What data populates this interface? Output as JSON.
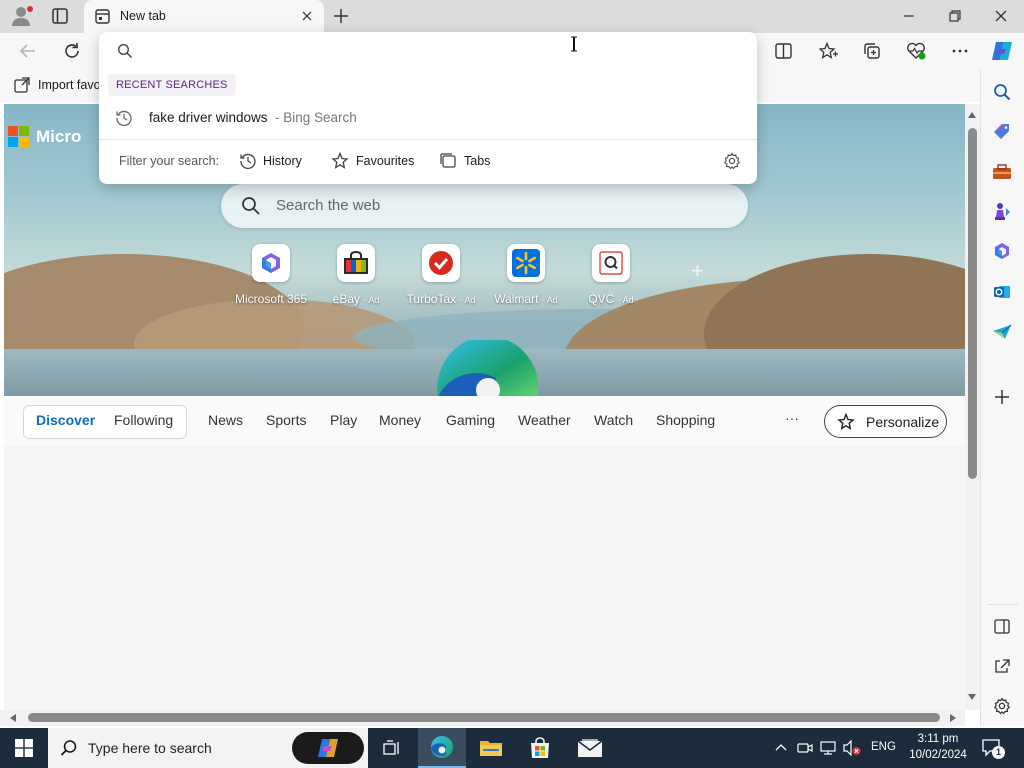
{
  "window": {
    "tab_title": "New tab"
  },
  "favorites_bar": {
    "import_label": "Import favo"
  },
  "address_dropdown": {
    "section_title": "RECENT SEARCHES",
    "recent": [
      {
        "query": "fake driver windows",
        "suffix": "- Bing Search"
      }
    ],
    "filter_label": "Filter your search:",
    "filters": [
      "History",
      "Favourites",
      "Tabs"
    ]
  },
  "newtab": {
    "brand_text": "Micro",
    "search_placeholder": "Search the web",
    "quick_links": [
      {
        "label": "Microsoft 365",
        "ad": ""
      },
      {
        "label": "eBay",
        "ad": "· Ad"
      },
      {
        "label": "TurboTax",
        "ad": "· Ad"
      },
      {
        "label": "Walmart",
        "ad": "· Ad"
      },
      {
        "label": "QVC",
        "ad": "· Ad"
      }
    ],
    "add_shortcut": "+",
    "feed_tabs": {
      "discover": "Discover",
      "following": "Following",
      "items": [
        "News",
        "Sports",
        "Play",
        "Money",
        "Gaming",
        "Weather",
        "Watch",
        "Shopping"
      ],
      "more": "···",
      "personalize": "Personalize"
    }
  },
  "taskbar": {
    "search_placeholder": "Type here to search",
    "language": "ENG",
    "time": "3:11 pm",
    "date": "10/02/2024",
    "notification_count": "1"
  },
  "colors": {
    "accent": "#0f6cbd",
    "taskbar_bg": "#1c2c3c",
    "hero_sky": "#86b7c7"
  }
}
